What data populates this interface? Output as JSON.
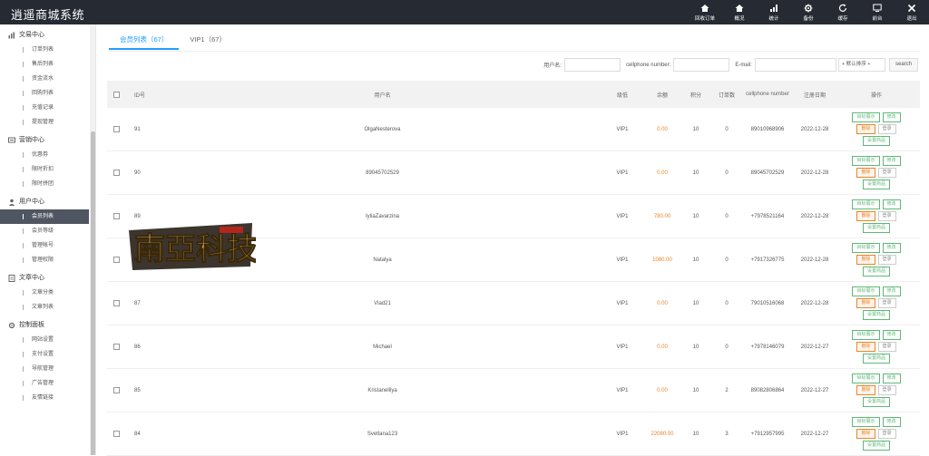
{
  "app": {
    "title": "逍遥商城系统"
  },
  "topnav": [
    {
      "label": "回收订单",
      "icon": "home-icon"
    },
    {
      "label": "概况",
      "icon": "home-icon"
    },
    {
      "label": "统计",
      "icon": "bar-chart-icon"
    },
    {
      "label": "备份",
      "icon": "gear-icon"
    },
    {
      "label": "缓存",
      "icon": "refresh-icon"
    },
    {
      "label": "前台",
      "icon": "monitor-icon"
    },
    {
      "label": "退出",
      "icon": "close-icon"
    }
  ],
  "sidebar": {
    "groups": [
      {
        "title": "交易中心",
        "icon": "chart-icon",
        "items": [
          "订单列表",
          "售后列表",
          "资金流水",
          "回购列表",
          "充值记录",
          "提现管理"
        ]
      },
      {
        "title": "营销中心",
        "icon": "cart-icon",
        "items": [
          "优惠券",
          "限时折扣",
          "限时拼团"
        ]
      },
      {
        "title": "用户中心",
        "icon": "user-icon",
        "items": [
          "会员列表",
          "会员等级",
          "管理帐号",
          "管理权限"
        ]
      },
      {
        "title": "文章中心",
        "icon": "document-icon",
        "items": [
          "文章分类",
          "文章列表"
        ]
      },
      {
        "title": "控制面板",
        "icon": "gear-icon",
        "items": [
          "网站设置",
          "支付设置",
          "导航管理",
          "广告管理",
          "友情链接"
        ]
      }
    ],
    "active": "会员列表"
  },
  "tabs": [
    {
      "label": "会员列表（67）",
      "active": true
    },
    {
      "label": "VIP1（67）",
      "active": false
    }
  ],
  "search": {
    "username_label": "用户名:",
    "phone_label": "cellphone number:",
    "email_label": "E-mail:",
    "sort_value": "+ 默认排序 +",
    "button": "search"
  },
  "table": {
    "headers": {
      "id": "ID号",
      "name": "用户名",
      "grade": "级低",
      "balance": "余额",
      "points": "积分",
      "orders": "订单数",
      "phone": "cellphone number",
      "date": "注册日期",
      "ops": "操作"
    },
    "rows": [
      {
        "id": "91",
        "name": "OlgaNesterova",
        "grade": "VIP1",
        "balance": "0.00",
        "points": "10",
        "orders": "0",
        "phone": "89010968906",
        "date": "2022-12-28"
      },
      {
        "id": "90",
        "name": "89045702529",
        "grade": "VIP1",
        "balance": "0.00",
        "points": "10",
        "orders": "0",
        "phone": "89045702529",
        "date": "2022-12-28"
      },
      {
        "id": "89",
        "name": "IyliaZavarzina",
        "grade": "VIP1",
        "balance": "780.00",
        "points": "10",
        "orders": "0",
        "phone": "+7978521164",
        "date": "2022-12-28"
      },
      {
        "id": "88",
        "name": "Natalya",
        "grade": "VIP1",
        "balance": "1080.00",
        "points": "10",
        "orders": "0",
        "phone": "+7917326775",
        "date": "2022-12-28"
      },
      {
        "id": "87",
        "name": "Vlad21",
        "grade": "VIP1",
        "balance": "0.00",
        "points": "10",
        "orders": "0",
        "phone": "79010516068",
        "date": "2022-12-28"
      },
      {
        "id": "86",
        "name": "Michael",
        "grade": "VIP1",
        "balance": "0.00",
        "points": "10",
        "orders": "0",
        "phone": "+7978146079",
        "date": "2022-12-27"
      },
      {
        "id": "85",
        "name": "Kristanelliya",
        "grade": "VIP1",
        "balance": "0.00",
        "points": "10",
        "orders": "2",
        "phone": "89082806864",
        "date": "2022-12-27"
      },
      {
        "id": "84",
        "name": "Svetlana123",
        "grade": "VIP1",
        "balance": "22080.00",
        "points": "10",
        "orders": "3",
        "phone": "+7912957995",
        "date": "2022-12-27"
      }
    ],
    "ops": {
      "show": "目标展示",
      "edit": "修改",
      "delete": "删除",
      "login": "登录",
      "set_goods": "设置商品"
    }
  },
  "colors": {
    "topbar": "#262a33",
    "accent": "#1e9fff",
    "ok": "#5fb878",
    "warn": "#e8862a"
  }
}
